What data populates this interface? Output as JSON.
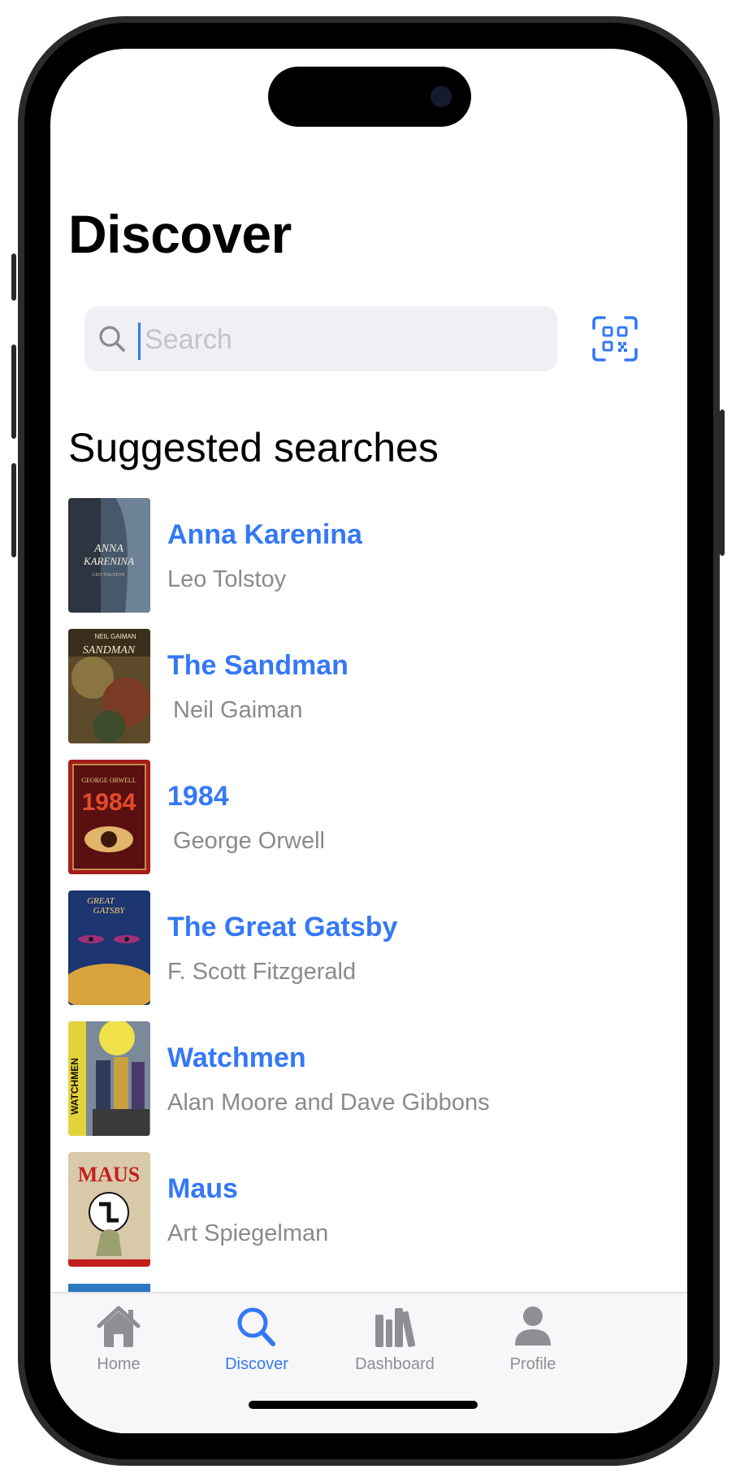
{
  "header": {
    "title": "Discover"
  },
  "search": {
    "placeholder": "Search",
    "value": ""
  },
  "suggested": {
    "heading": "Suggested searches",
    "books": [
      {
        "title": "Anna Karenina",
        "author": "Leo Tolstoy",
        "cover_color": "#2c3540",
        "cover_text": "ANNA KARENINA"
      },
      {
        "title": "The Sandman",
        "author": "Neil Gaiman",
        "cover_color": "#6b5a32",
        "cover_text": "SANDMAN"
      },
      {
        "title": "1984",
        "author": "George Orwell",
        "cover_color": "#8a1515",
        "cover_text": "1984"
      },
      {
        "title": "The Great Gatsby",
        "author": "F. Scott Fitzgerald",
        "cover_color": "#1d3570",
        "cover_text": "GATSBY"
      },
      {
        "title": "Watchmen",
        "author": "Alan Moore and Dave Gibbons",
        "cover_color": "#e3d33a",
        "cover_text": "WATCHMEN"
      },
      {
        "title": "Maus",
        "author": "Art Spiegelman",
        "cover_color": "#d8c9a8",
        "cover_text": "MAUS"
      }
    ]
  },
  "tabbar": {
    "active": "Discover",
    "tabs": [
      {
        "label": "Home",
        "icon": "house-icon"
      },
      {
        "label": "Discover",
        "icon": "search-icon"
      },
      {
        "label": "Dashboard",
        "icon": "books-icon"
      },
      {
        "label": "Profile",
        "icon": "person-icon"
      }
    ]
  },
  "colors": {
    "accent": "#3478f6",
    "secondary_text": "#8a8a8e",
    "search_bg": "#efeff4"
  }
}
